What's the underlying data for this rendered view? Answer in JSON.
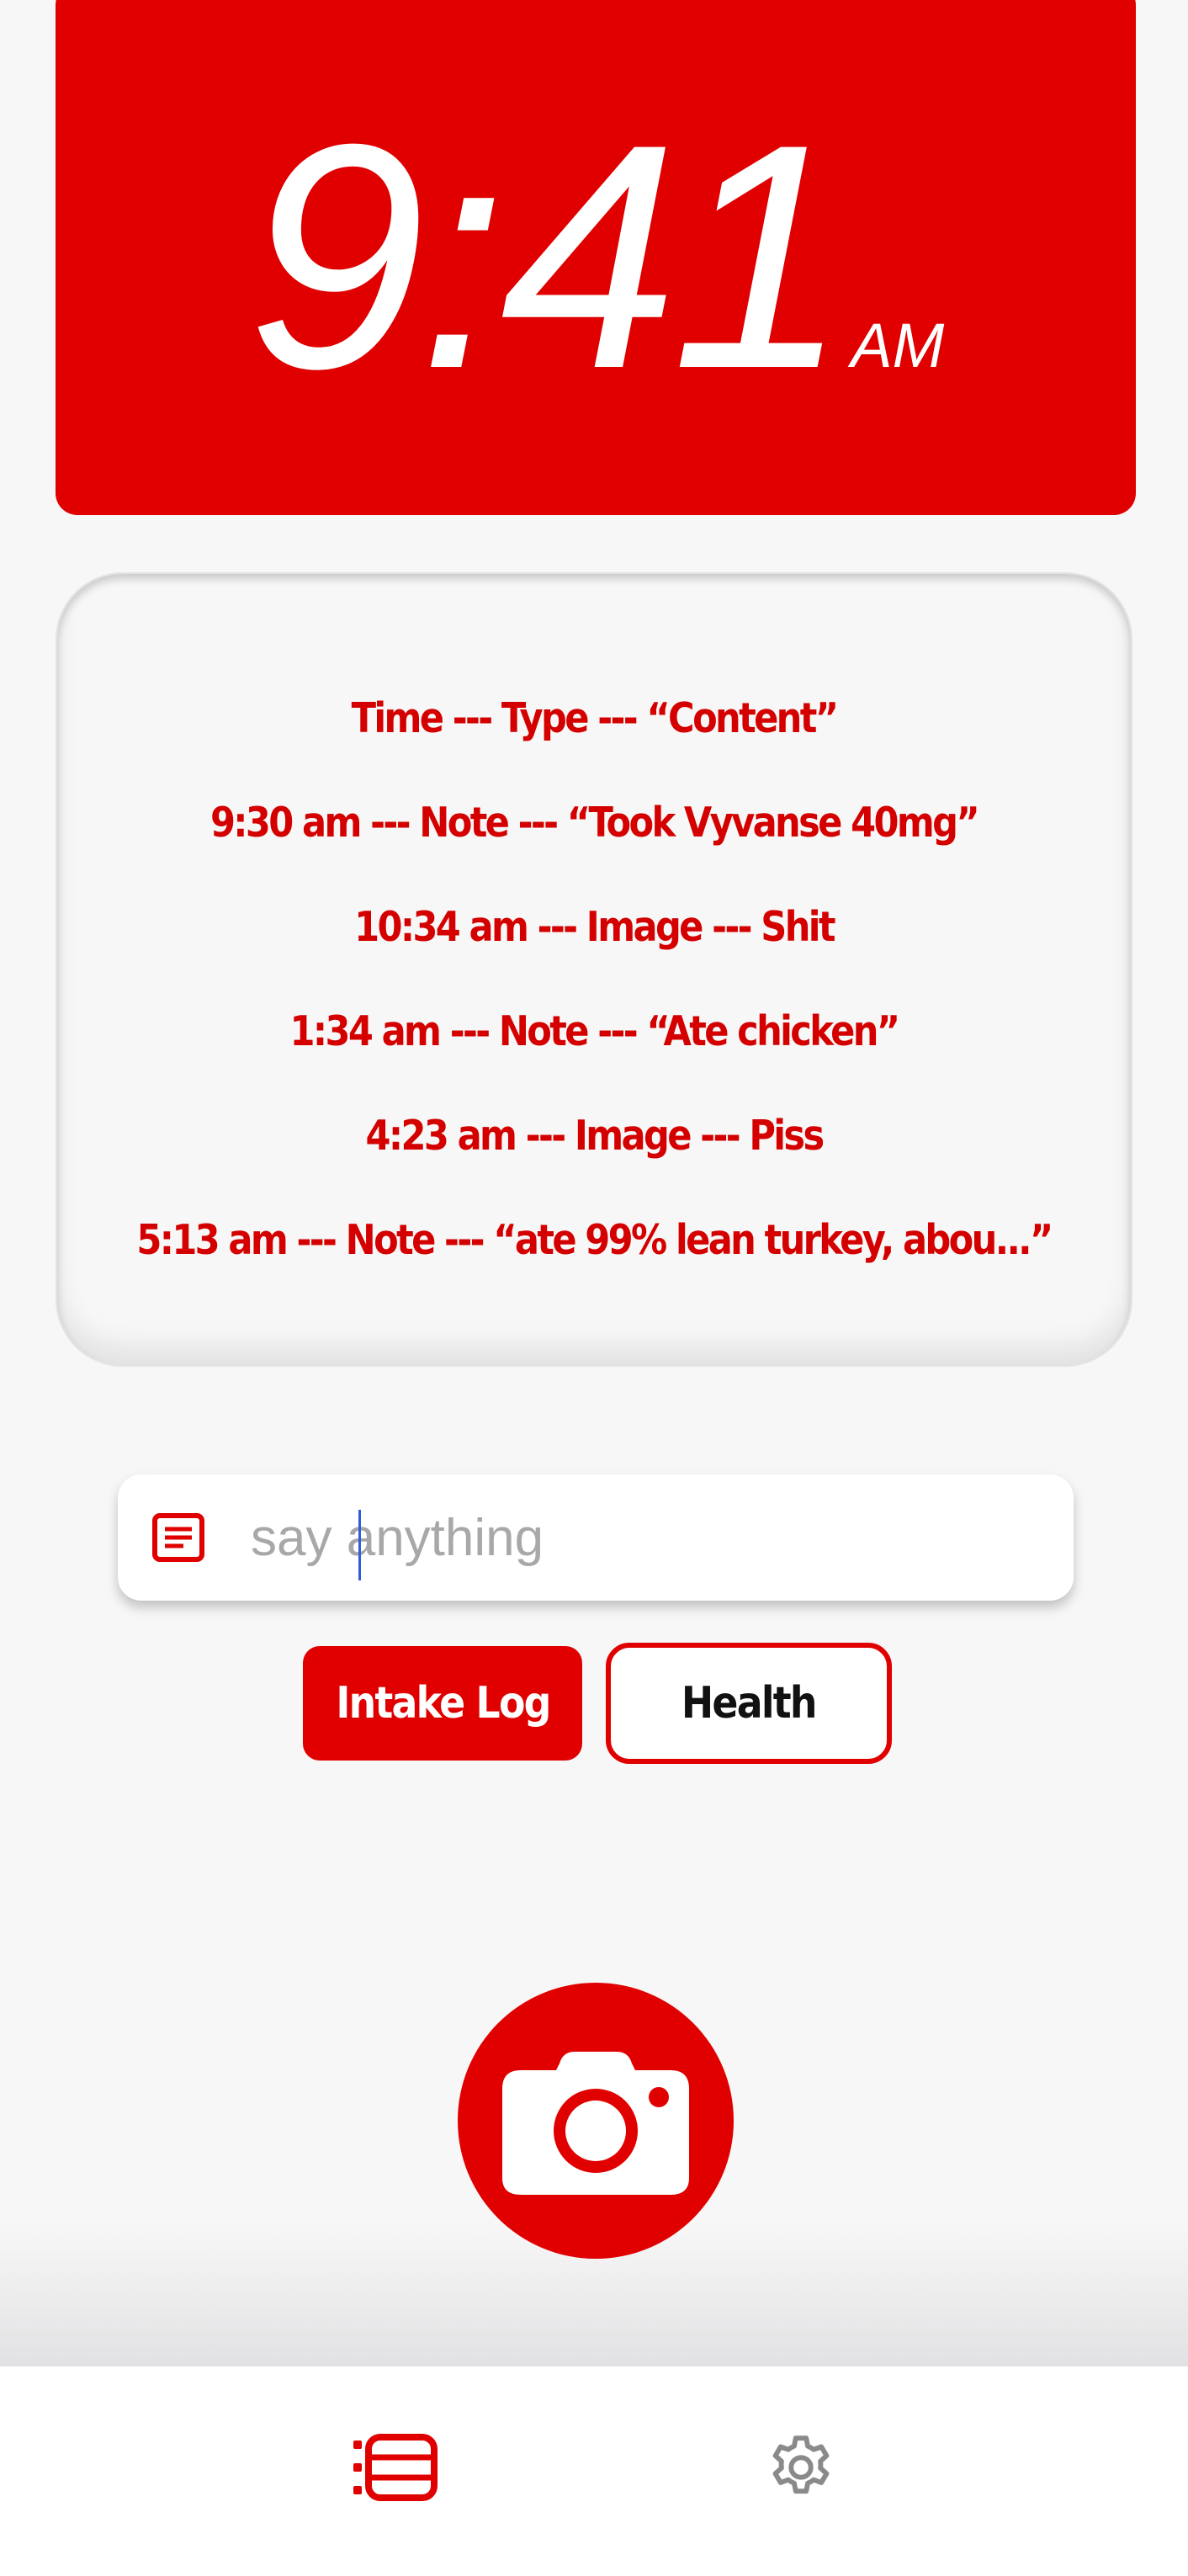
{
  "clock": {
    "time": "9:41",
    "period": "AM"
  },
  "log": {
    "header": "Time --- Type --- “Content”",
    "entries": [
      "9:30 am --- Note --- “Took Vyvanse 40mg”",
      "10:34 am --- Image --- Shit",
      "1:34 am --- Note --- “Ate chicken”",
      "4:23 am --- Image --- Piss",
      "5:13 am --- Note --- “ate 99% lean turkey, abou...”"
    ]
  },
  "input": {
    "placeholder": "say anything",
    "value": "",
    "icon": "note-icon"
  },
  "buttons": {
    "intake_log": "Intake Log",
    "health": "Health"
  },
  "camera": {
    "icon": "camera-icon"
  },
  "tabbar": {
    "items": [
      {
        "icon": "intake-list-icon",
        "selected": true
      },
      {
        "icon": "gear-icon",
        "selected": false
      }
    ]
  },
  "colors": {
    "accent": "#e00000",
    "background": "#f7f7f7",
    "inactive_icon": "#8a8a8a"
  }
}
